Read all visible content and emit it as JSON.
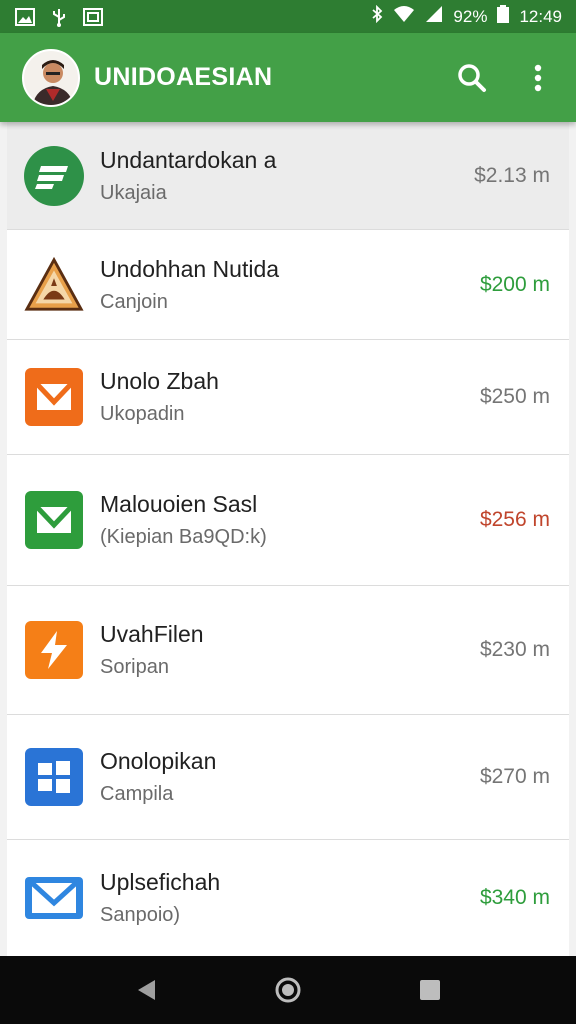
{
  "status_bar": {
    "battery": "92%",
    "time": "12:49",
    "icons": [
      "image-icon",
      "usb-icon",
      "gallery-icon",
      "bluetooth-icon",
      "wifi-icon",
      "signal-icon",
      "battery-icon"
    ]
  },
  "app_bar": {
    "title": "UNIDOAESIAN",
    "search_icon": "search-icon",
    "menu_icon": "more-vert-icon",
    "color": "#43a047",
    "status_color": "#2e7d32"
  },
  "items": [
    {
      "title": "Undantardokan a",
      "subtitle": "Ukajaia",
      "amount": "$2.13 m",
      "amount_color": "#757575",
      "icon": "document-icon",
      "icon_color": "#2e9148"
    },
    {
      "title": "Undohhan Nutida",
      "subtitle": "Canjoin",
      "amount": "$200 m",
      "amount_color": "#2e9d3c",
      "icon": "triangle-emblem-icon",
      "icon_color": "#e07a20"
    },
    {
      "title": "Unolo Zbah",
      "subtitle": "Ukopadin",
      "amount": "$250 m",
      "amount_color": "#757575",
      "icon": "mail-icon",
      "icon_color": "#ef6c1a"
    },
    {
      "title": "Malouoien Sasl",
      "subtitle": "(Kiepian Ba9QD:k)",
      "amount": "$256 m",
      "amount_color": "#c0452c",
      "icon": "mail-icon",
      "icon_color": "#2e9d3c"
    },
    {
      "title": "UvahFilen",
      "subtitle": "Soripan",
      "amount": "$230 m",
      "amount_color": "#757575",
      "icon": "bolt-icon",
      "icon_color": "#f57f17"
    },
    {
      "title": "Onolopikan",
      "subtitle": "Campila",
      "amount": "$270 m",
      "amount_color": "#757575",
      "icon": "windows-icon",
      "icon_color": "#2a74d6"
    },
    {
      "title": "Uplsefichah",
      "subtitle": "Sanpoio)",
      "amount": "$340 m",
      "amount_color": "#2e9d3c",
      "icon": "mail-icon",
      "icon_color": "#2f86e0"
    }
  ],
  "nav_bar": {
    "back_icon": "back-icon",
    "home_icon": "home-icon",
    "recents_icon": "recents-icon"
  }
}
